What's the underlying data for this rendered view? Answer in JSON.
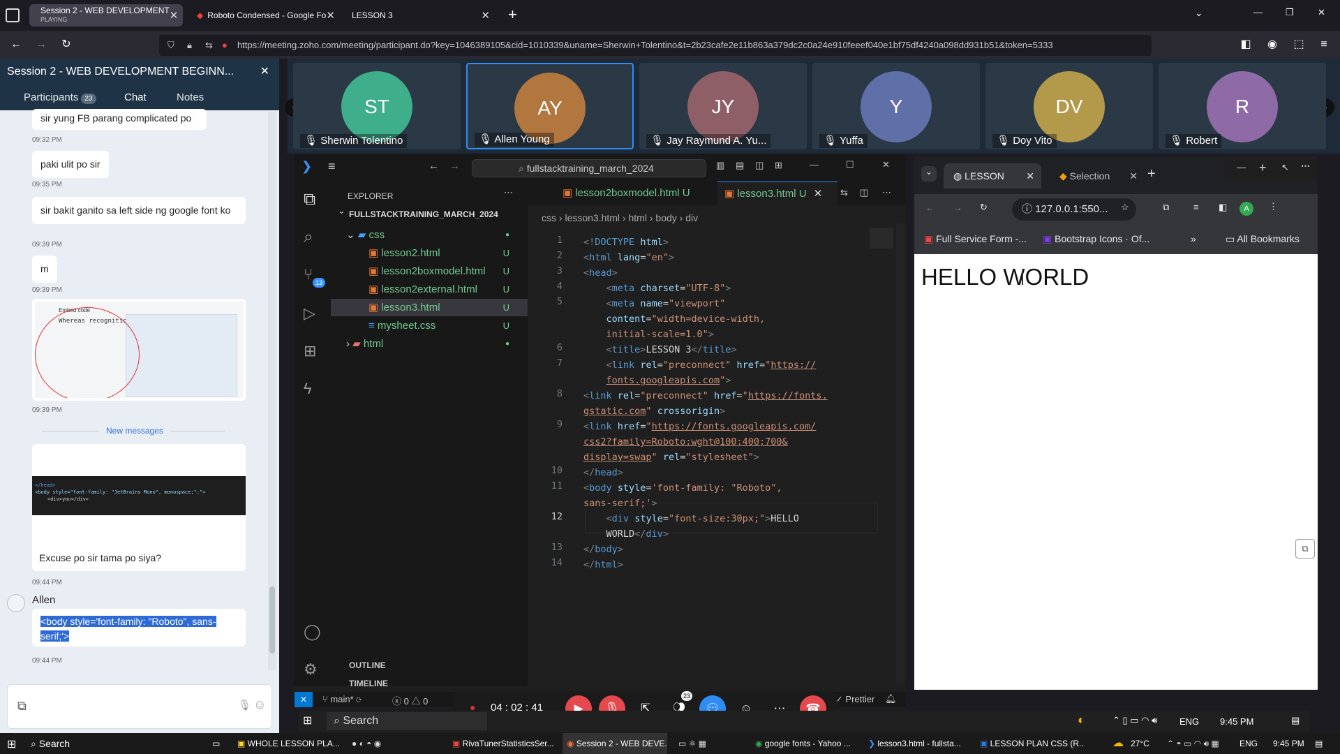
{
  "firefox": {
    "tabs": [
      {
        "title": "Session 2 - WEB DEVELOPMENT",
        "subtitle": "PLAYING"
      },
      {
        "title": "Roboto Condensed - Google Fo"
      },
      {
        "title": "LESSON 3"
      }
    ],
    "url": "https://meeting.zoho.com/meeting/participant.do?key=1046389105&cid=1010339&uname=Sherwin+Tolentino&t=2b23cafe2e11b863a379dc2c0a24e910feeef040e1bf75df4240a098dd931b51&token=5333"
  },
  "chat": {
    "title": "Session 2 - WEB DEVELOPMENT BEGINN...",
    "tabs": {
      "participants": "Participants",
      "participants_count": "23",
      "chat": "Chat",
      "notes": "Notes"
    },
    "messages": [
      {
        "text": "sir yung FB parang complicated po",
        "time": "09:32 PM"
      },
      {
        "text": "paki ulit po sir",
        "time": "09:35 PM"
      },
      {
        "text": "sir bakit ganito sa left side ng google font ko",
        "time": "09:39 PM"
      },
      {
        "text": "m",
        "time": "09:39 PM"
      },
      {
        "image_label": "Embed code",
        "thumb_text": "Whereas recognitio",
        "time": "09:39 PM"
      }
    ],
    "new_messages": "New messages",
    "code_image": {
      "line1": "</head>",
      "line2": "<body style=\"font-family: \"JetBrains Mono\", monospace;\";\">",
      "line3": "<div>you</div>"
    },
    "message_after_image": "Excuse po sir tama po siya?",
    "time_after_image": "09:44 PM",
    "sender": "Allen",
    "selected_message": "<body style='font-family: \"Roboto\", sans-serif;'>",
    "last_time": "09:44 PM"
  },
  "participants": [
    {
      "initials": "ST",
      "name": "Sherwin Tolentino",
      "color": "#3fae8a"
    },
    {
      "initials": "AY",
      "name": "Allen Young",
      "color": "#b2773e"
    },
    {
      "initials": "JY",
      "name": "Jay Raymund A. Yu...",
      "color": "#8f5f68"
    },
    {
      "initials": "Y",
      "name": "Yuffa",
      "color": "#5f6fa8"
    },
    {
      "initials": "DV",
      "name": "Doy Vito",
      "color": "#b39a4a"
    },
    {
      "initials": "R",
      "name": "Robert",
      "color": "#8e6ba6"
    }
  ],
  "vscode": {
    "search": "fullstacktraining_march_2024",
    "explorer_title": "EXPLORER",
    "root": "FULLSTACKTRAINING_MARCH_2024",
    "files": [
      {
        "name": "css",
        "type": "folder"
      },
      {
        "name": "lesson2.html",
        "status": "U"
      },
      {
        "name": "lesson2boxmodel.html",
        "status": "U"
      },
      {
        "name": "lesson2external.html",
        "status": "U"
      },
      {
        "name": "lesson3.html",
        "status": "U"
      },
      {
        "name": "mysheet.css",
        "status": "U"
      },
      {
        "name": "html",
        "type": "folder"
      }
    ],
    "outline": "OUTLINE",
    "timeline": "TIMELINE",
    "editor_tabs": [
      {
        "name": "lesson2boxmodel.html",
        "status": "U"
      },
      {
        "name": "lesson3.html",
        "status": "U"
      }
    ],
    "breadcrumb": [
      "css",
      "lesson3.html",
      "html",
      "body",
      "div"
    ],
    "scm_badge": "13",
    "status": {
      "branch": "main*",
      "errors": "0",
      "warnings": "0",
      "prettier": "Prettier"
    }
  },
  "code_lines": [
    {
      "n": "1",
      "html": "<span class='gr'>&lt;!</span><span class='tg'>DOCTYPE</span> <span class='at'>html</span><span class='gr'>&gt;</span>"
    },
    {
      "n": "2",
      "html": "<span class='gr'>&lt;</span><span class='tg'>html</span> <span class='at'>lang</span>=<span class='st'>\"en\"</span><span class='gr'>&gt;</span>"
    },
    {
      "n": "3",
      "html": "<span class='gr'>&lt;</span><span class='tg'>head</span><span class='gr'>&gt;</span>"
    },
    {
      "n": "4",
      "html": "    <span class='gr'>&lt;</span><span class='tg'>meta</span> <span class='at'>charset</span>=<span class='st'>\"UTF-8\"</span><span class='gr'>&gt;</span>"
    },
    {
      "n": "5",
      "html": "    <span class='gr'>&lt;</span><span class='tg'>meta</span> <span class='at'>name</span>=<span class='st'>\"viewport\"</span>"
    }
  ],
  "chrome": {
    "tabs": [
      "LESSON",
      "Selection"
    ],
    "url": "127.0.0.1:550...",
    "profile": "A",
    "bookmarks": [
      "Full Service Form -...",
      "Bootstrap Icons · Of...",
      "All Bookmarks"
    ],
    "page_text": "HELLO WORLD"
  },
  "meeting": {
    "timer": "04 : 02 : 41",
    "participants_badge": "23"
  },
  "inner_taskbar": {
    "search": "Search",
    "weather": "",
    "lang": "ENG",
    "time": "9:45 PM"
  },
  "host_taskbar": {
    "search": "Search",
    "items": [
      "WHOLE LESSON PLA...",
      "RivaTunerStatisticsSer...",
      "Session 2 - WEB DEVE...",
      "google fonts - Yahoo ...",
      "lesson3.html - fullsta...",
      "LESSON PLAN CSS (R..."
    ],
    "temp": "27°C",
    "lang": "ENG",
    "time": "9:45 PM"
  }
}
